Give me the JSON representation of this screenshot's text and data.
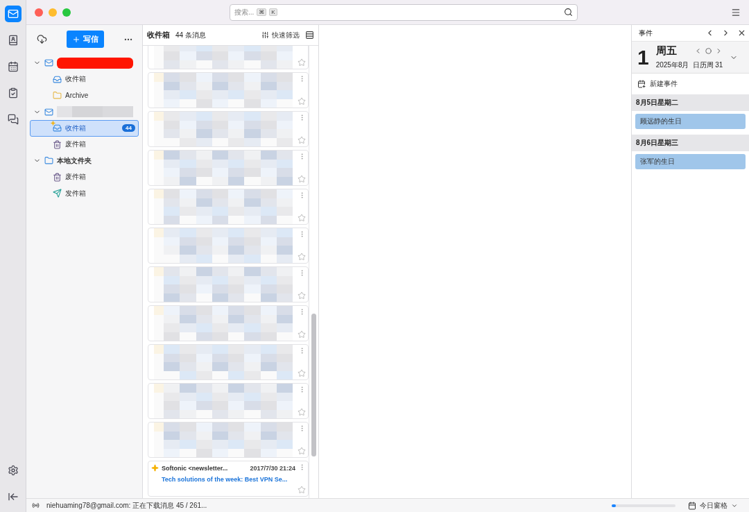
{
  "search": {
    "placeholder": "搜索...",
    "keys": [
      "⌘",
      "K"
    ]
  },
  "folder_pane": {
    "write_button": "写信",
    "tree": [
      {
        "kind": "redacted-account",
        "expanded": true,
        "children": [
          {
            "kind": "inbox",
            "name": "收件箱",
            "selected": false,
            "new_mail": false
          },
          {
            "kind": "archive",
            "name": "Archive",
            "selected": false,
            "new_mail": false
          }
        ]
      },
      {
        "kind": "blurred-account",
        "expanded": true,
        "children": [
          {
            "kind": "inbox",
            "name": "收件箱",
            "selected": true,
            "new_mail": true,
            "unread": "44"
          },
          {
            "kind": "trash",
            "name": "废件箱",
            "selected": false,
            "new_mail": false
          }
        ]
      },
      {
        "kind": "local",
        "name": "本地文件夹",
        "expanded": true,
        "children": [
          {
            "kind": "trash",
            "name": "废件箱",
            "selected": false,
            "new_mail": false
          },
          {
            "kind": "sent",
            "name": "发件箱",
            "selected": false,
            "new_mail": false
          }
        ]
      }
    ]
  },
  "message_list": {
    "title": "收件箱",
    "count": "44 条消息",
    "quick_filter": "快速筛选",
    "messages": [
      {
        "kind": "hidden",
        "starred": false
      },
      {
        "kind": "hidden",
        "starred": false
      },
      {
        "kind": "hidden",
        "starred": false
      },
      {
        "kind": "hidden",
        "starred": false
      },
      {
        "kind": "hidden",
        "starred": false
      },
      {
        "kind": "hidden",
        "starred": false
      },
      {
        "kind": "hidden",
        "starred": false
      },
      {
        "kind": "hidden",
        "starred": false
      },
      {
        "kind": "hidden",
        "starred": false
      },
      {
        "kind": "hidden",
        "starred": false
      },
      {
        "kind": "hidden",
        "starred": false
      },
      {
        "kind": "message",
        "sender": "Softonic <newsletter...",
        "date": "2017/7/30 21:24",
        "subject": "Tech solutions of the week: Best VPN Se...",
        "starred": false
      }
    ]
  },
  "today_pane": {
    "title": "事件",
    "day": "1",
    "weekday": "周五",
    "month": "2025年8月",
    "week": "日历周 31",
    "new_event": "新建事件",
    "groups": [
      {
        "date": "8月5日星期二",
        "events": [
          {
            "title": "顾远静的生日"
          }
        ]
      },
      {
        "date": "8月6日星期三",
        "events": [
          {
            "title": "张军的生日"
          }
        ]
      }
    ]
  },
  "status_bar": {
    "text": "niehuaming78@gmail.com: 正在下载消息 45 / 261...",
    "level": 0.06,
    "today_pane_button": "今日窗格"
  }
}
